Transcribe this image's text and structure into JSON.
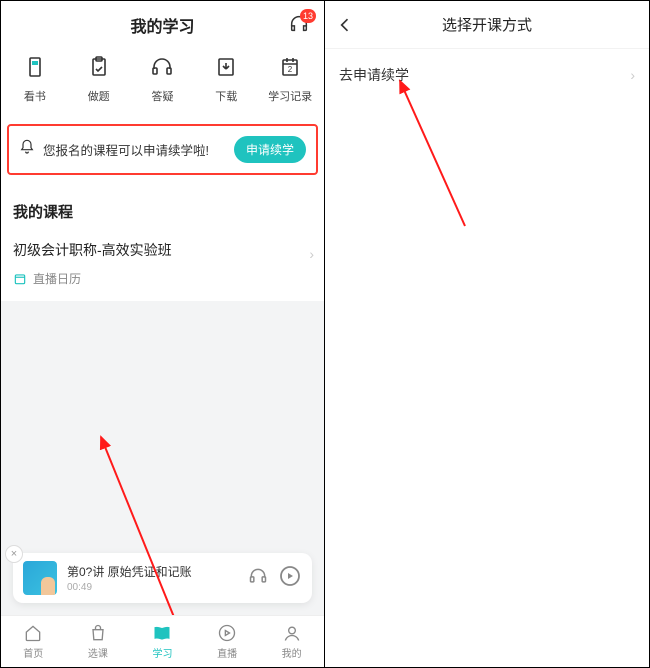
{
  "left": {
    "header": {
      "title": "我的学习",
      "badge": "13"
    },
    "nav": [
      {
        "label": "看书"
      },
      {
        "label": "做题"
      },
      {
        "label": "答疑"
      },
      {
        "label": "下载"
      },
      {
        "label": "学习记录"
      }
    ],
    "notice": {
      "text": "您报名的课程可以申请续学啦!",
      "button": "申请续学"
    },
    "section_title": "我的课程",
    "course": {
      "name": "初级会计职称-高效实验班",
      "calendar": "直播日历"
    },
    "player": {
      "title": "第0?讲  原始凭证和记账",
      "time": "00:49"
    },
    "tabs": [
      {
        "label": "首页"
      },
      {
        "label": "选课"
      },
      {
        "label": "学习"
      },
      {
        "label": "直播"
      },
      {
        "label": "我的"
      }
    ]
  },
  "right": {
    "title": "选择开课方式",
    "item": "去申请续学"
  }
}
